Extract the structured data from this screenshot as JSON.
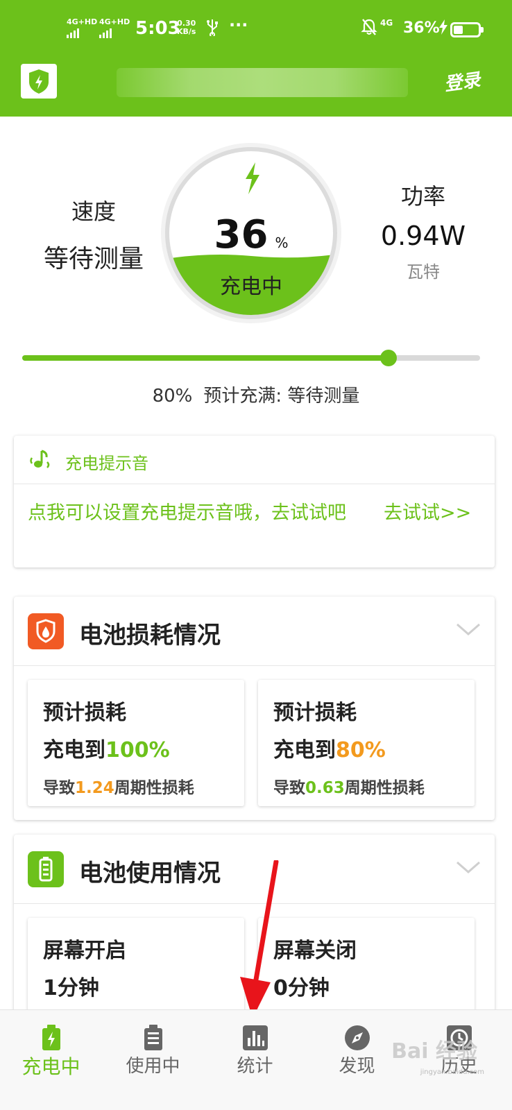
{
  "status_bar": {
    "sim1": "4G+HD",
    "sim2": "4G+HD",
    "time": "5:03",
    "net_speed_value": "0.30",
    "net_speed_unit": "KB/s",
    "dots": "···",
    "network_type": "4G",
    "battery_percent": "36%",
    "battery_level": 0.36,
    "icons": [
      "signal-icon",
      "usb-icon",
      "mute-bell-icon",
      "charging-bolt-icon",
      "battery-icon"
    ]
  },
  "header": {
    "login_label": "登录",
    "accent_color": "#6cc11b"
  },
  "charging": {
    "speed_label": "速度",
    "speed_value": "等待测量",
    "power_label": "功率",
    "power_value": "0.94W",
    "power_unit": "瓦特",
    "percent_value": "36",
    "percent_symbol": "%",
    "status": "充电中",
    "level": 0.36
  },
  "charge_limit": {
    "percent_label": "80%",
    "eta_label": "预计充满: 等待测量",
    "slider_value": 0.8
  },
  "tone_card": {
    "title": "充电提示音",
    "message": "点我可以设置充电提示音哦，去试试吧",
    "action": "去试试>>"
  },
  "battery_loss": {
    "title": "电池损耗情况",
    "cards": [
      {
        "line1": "预计损耗",
        "line2_prefix": "充电到",
        "line2_value": "100%",
        "line3_prefix": "导致",
        "line3_value": "1.24",
        "line3_suffix": "周期性损耗"
      },
      {
        "line1": "预计损耗",
        "line2_prefix": "充电到",
        "line2_value": "80%",
        "line3_prefix": "导致",
        "line3_value": "0.63",
        "line3_suffix": "周期性损耗"
      }
    ]
  },
  "battery_usage": {
    "title": "电池使用情况",
    "cards": [
      {
        "label": "屏幕开启",
        "value": "1分钟"
      },
      {
        "label": "屏幕关闭",
        "value": "0分钟"
      }
    ]
  },
  "bottom_nav": {
    "items": [
      {
        "label": "充电中",
        "icon": "charging-battery-icon",
        "active": true
      },
      {
        "label": "使用中",
        "icon": "battery-list-icon",
        "active": false
      },
      {
        "label": "统计",
        "icon": "bar-chart-icon",
        "active": false
      },
      {
        "label": "发现",
        "icon": "compass-icon",
        "active": false
      },
      {
        "label": "历史",
        "icon": "clock-icon",
        "active": false
      }
    ]
  },
  "watermark": {
    "text": "Bai 经验",
    "sub": "jingyan.baidu.com"
  }
}
